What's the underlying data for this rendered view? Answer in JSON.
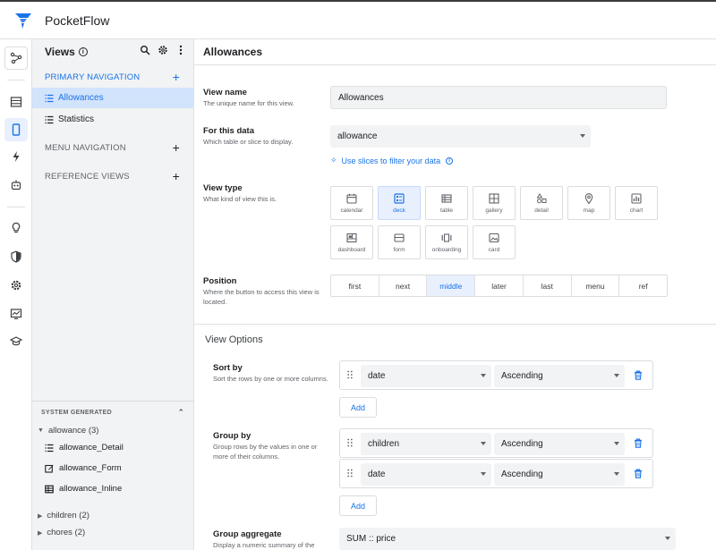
{
  "app": {
    "title": "PocketFlow"
  },
  "views_panel": {
    "title": "Views",
    "primary_nav": {
      "label": "PRIMARY NAVIGATION",
      "items": [
        "Allowances",
        "Statistics"
      ]
    },
    "menu_nav": {
      "label": "MENU NAVIGATION"
    },
    "reference_views": {
      "label": "REFERENCE VIEWS"
    },
    "system_generated": {
      "label": "SYSTEM GENERATED",
      "groups": [
        {
          "label": "allowance (3)",
          "items": [
            "allowance_Detail",
            "allowance_Form",
            "allowance_Inline"
          ]
        },
        {
          "label": "children (2)"
        },
        {
          "label": "chores (2)"
        }
      ]
    }
  },
  "main": {
    "title": "Allowances",
    "view_name": {
      "label": "View name",
      "desc": "The unique name for this view.",
      "value": "Allowances"
    },
    "for_data": {
      "label": "For this data",
      "desc": "Which table or slice to display.",
      "value": "allowance",
      "link": "Use slices to filter your data"
    },
    "view_type": {
      "label": "View type",
      "desc": "What kind of view this is.",
      "options": [
        "calendar",
        "deck",
        "table",
        "gallery",
        "detail",
        "map",
        "chart",
        "dashboard",
        "form",
        "onboarding",
        "card"
      ],
      "selected": "deck"
    },
    "position": {
      "label": "Position",
      "desc": "Where the button to access this view is located.",
      "options": [
        "first",
        "next",
        "middle",
        "later",
        "last",
        "menu",
        "ref"
      ],
      "selected": "middle"
    },
    "view_options": {
      "title": "View Options",
      "sort_by": {
        "label": "Sort by",
        "desc": "Sort the rows by one or more columns.",
        "rows": [
          {
            "column": "date",
            "order": "Ascending"
          }
        ],
        "add_label": "Add"
      },
      "group_by": {
        "label": "Group by",
        "desc": "Group rows by the values in one or more of their columns.",
        "rows": [
          {
            "column": "children",
            "order": "Ascending"
          },
          {
            "column": "date",
            "order": "Ascending"
          }
        ],
        "add_label": "Add"
      },
      "group_aggregate": {
        "label": "Group aggregate",
        "desc": "Display a numeric summary of the",
        "value": "SUM :: price"
      }
    }
  },
  "colors": {
    "accent": "#1a73e8",
    "active_bg": "#d2e3fc",
    "panel_bg": "#f1f3f4"
  }
}
